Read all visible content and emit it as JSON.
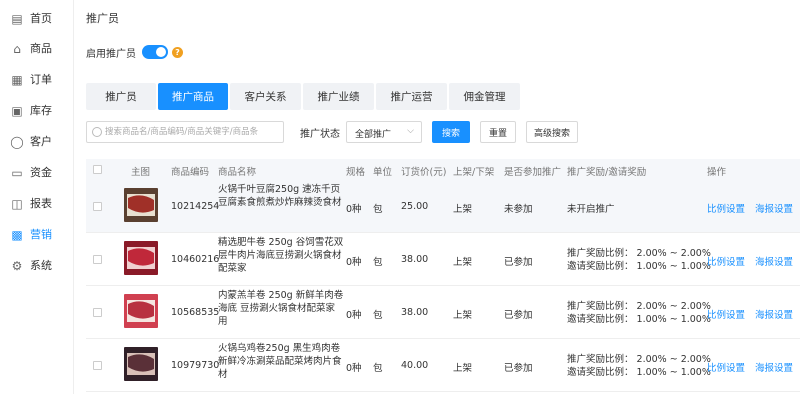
{
  "sidebar": {
    "items": [
      {
        "label": "首页",
        "icon": "home-icon",
        "glyph": "▤"
      },
      {
        "label": "商品",
        "icon": "bag-icon",
        "glyph": "⌂"
      },
      {
        "label": "订单",
        "icon": "order-icon",
        "glyph": "▦"
      },
      {
        "label": "库存",
        "icon": "inventory-icon",
        "glyph": "▣"
      },
      {
        "label": "客户",
        "icon": "user-icon",
        "glyph": "◯"
      },
      {
        "label": "资金",
        "icon": "wallet-icon",
        "glyph": "▭"
      },
      {
        "label": "报表",
        "icon": "report-icon",
        "glyph": "◫"
      },
      {
        "label": "营销",
        "icon": "gift-icon",
        "glyph": "▩"
      },
      {
        "label": "系统",
        "icon": "settings-icon",
        "glyph": "⚙"
      }
    ],
    "active_index": 7
  },
  "page": {
    "title": "推广员",
    "toggle_label": "启用推广员",
    "toggle_on": true,
    "help_glyph": "?"
  },
  "tabs": [
    {
      "label": "推广员",
      "active": false
    },
    {
      "label": "推广商品",
      "active": true
    },
    {
      "label": "客户关系",
      "active": false
    },
    {
      "label": "推广业绩",
      "active": false
    },
    {
      "label": "推广运营",
      "active": false
    },
    {
      "label": "佣金管理",
      "active": false
    }
  ],
  "filter": {
    "search_placeholder": "搜索商品名/商品编码/商品关键字/商品条",
    "status_label": "推广状态",
    "status_value": "全部推广",
    "search_button": "搜索",
    "reset_button": "重置",
    "advanced_button": "高级搜索"
  },
  "table": {
    "headers": {
      "image": "主图",
      "code": "商品编码",
      "name": "商品名称",
      "spec": "规格",
      "unit": "单位",
      "price": "订货价(元)",
      "shelf": "上架/下架",
      "joined": "是否参加推广",
      "reward": "推广奖励/邀请奖励",
      "ops": "操作"
    },
    "rows": [
      {
        "code": "10214254",
        "name": "火锅千叶豆腐250g 速冻千页豆腐素食煎煮炒炸麻辣烫食材",
        "spec": "0种",
        "unit": "包",
        "price": "25.00",
        "shelf": "上架",
        "joined": "未参加",
        "reward_line1": "未开启推广",
        "reward_line2": "",
        "op1": "比例设置",
        "op2": "海报设置",
        "thumb_colors": [
          "#a03028",
          "#e8e0d0",
          "#5a4030"
        ]
      },
      {
        "code": "10460216",
        "name": "精选肥牛卷 250g 谷饲雪花双层牛肉片海底豆捞涮火锅食材配菜家",
        "spec": "0种",
        "unit": "包",
        "price": "38.00",
        "shelf": "上架",
        "joined": "已参加",
        "reward_line1": "推广奖励比例： 2.00% ~ 2.00%",
        "reward_line2": "邀请奖励比例： 1.00% ~ 1.00%",
        "op1": "比例设置",
        "op2": "海报设置",
        "thumb_colors": [
          "#c0283a",
          "#f0d0d0",
          "#8a1a28"
        ]
      },
      {
        "code": "10568535",
        "name": "内蒙羔羊卷 250g 新鲜羊肉卷海底 豆捞涮火锅食材配菜家用",
        "spec": "0种",
        "unit": "包",
        "price": "38.00",
        "shelf": "上架",
        "joined": "已参加",
        "reward_line1": "推广奖励比例： 2.00% ~ 2.00%",
        "reward_line2": "邀请奖励比例： 1.00% ~ 1.00%",
        "op1": "比例设置",
        "op2": "海报设置",
        "thumb_colors": [
          "#b83040",
          "#f5e5e0",
          "#d04050"
        ]
      },
      {
        "code": "10979730",
        "name": "火锅乌鸡卷250g 黑生鸡肉卷新鲜冷冻涮菜品配菜烤肉片食材",
        "spec": "0种",
        "unit": "包",
        "price": "40.00",
        "shelf": "上架",
        "joined": "已参加",
        "reward_line1": "推广奖励比例： 2.00% ~ 2.00%",
        "reward_line2": "邀请奖励比例： 1.00% ~ 1.00%",
        "op1": "比例设置",
        "op2": "海报设置",
        "thumb_colors": [
          "#5a3038",
          "#d8c0b8",
          "#302028"
        ]
      }
    ]
  },
  "colors": {
    "accent": "#1890ff",
    "help": "#f0a020"
  }
}
